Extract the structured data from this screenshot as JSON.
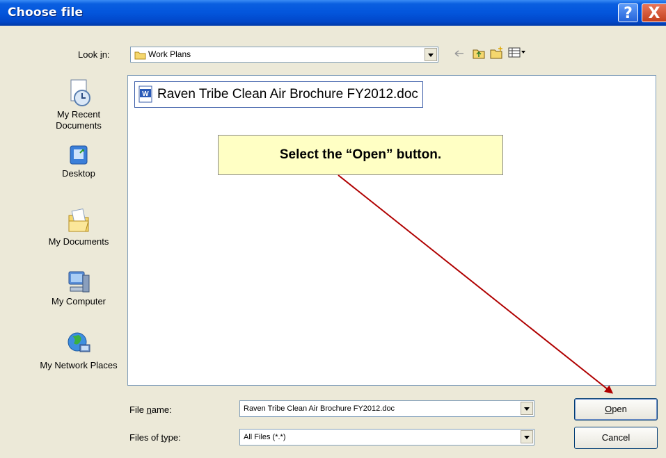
{
  "window": {
    "title": "Choose file",
    "help_label": "?",
    "close_label": "X"
  },
  "toolbar": {
    "look_in_label": "Look in:",
    "look_in_value": "Work Plans"
  },
  "places": [
    {
      "label": "My Recent Documents",
      "icon": "recent-documents-icon"
    },
    {
      "label": "Desktop",
      "icon": "desktop-icon"
    },
    {
      "label": "My Documents",
      "icon": "my-documents-icon"
    },
    {
      "label": "My Computer",
      "icon": "my-computer-icon"
    },
    {
      "label": "My Network Places",
      "icon": "network-places-icon"
    }
  ],
  "files": [
    {
      "name": "Raven Tribe Clean Air Brochure FY2012.doc",
      "icon": "word-document-icon"
    }
  ],
  "callout": {
    "text": "Select the “Open” button."
  },
  "form": {
    "file_name_label": "File name:",
    "file_name_value": "Raven Tribe Clean Air Brochure FY2012.doc",
    "file_type_label": "Files of type:",
    "file_type_value": "All Files (*.*)"
  },
  "buttons": {
    "open": "Open",
    "cancel": "Cancel"
  },
  "colors": {
    "titlebar": "#0355dc",
    "dialog_bg": "#ece9d8",
    "callout_bg": "#ffffc4",
    "arrow": "#b00000"
  }
}
